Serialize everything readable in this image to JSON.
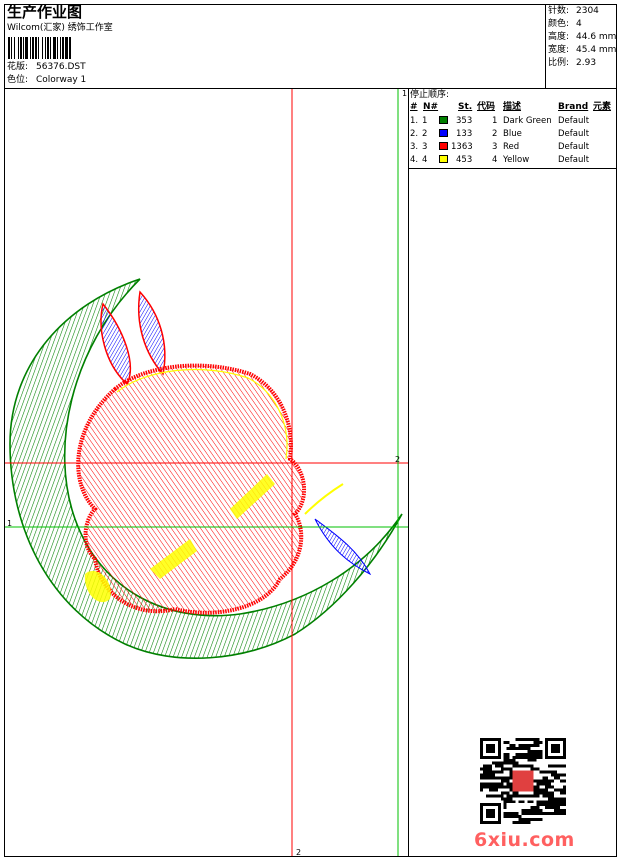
{
  "header": {
    "title": "生产作业图",
    "company": "Wilcom(汇家) 绣饰工作室",
    "design_label": "花版:",
    "design_value": "56376.DST",
    "colorway_label": "色位:",
    "colorway_value": "Colorway 1"
  },
  "stats": [
    {
      "label": "针数:",
      "value": "2304"
    },
    {
      "label": "颜色:",
      "value": "4"
    },
    {
      "label": "高度:",
      "value": "44.6 mm"
    },
    {
      "label": "宽度:",
      "value": "45.4 mm"
    },
    {
      "label": "比例:",
      "value": "2.93"
    }
  ],
  "stop_sequence": {
    "title": "停止顺序:",
    "columns": [
      "#",
      "N#",
      "St.",
      "代码",
      "描述",
      "Brand",
      "元素"
    ],
    "rows": [
      {
        "num": "1.",
        "n": "1",
        "color": "#008000",
        "st": "353",
        "code": "1",
        "desc": "Dark Green",
        "brand": "Default"
      },
      {
        "num": "2.",
        "n": "2",
        "color": "#0000ff",
        "st": "133",
        "code": "2",
        "desc": "Blue",
        "brand": "Default"
      },
      {
        "num": "3.",
        "n": "3",
        "color": "#ff0000",
        "st": "1363",
        "code": "3",
        "desc": "Red",
        "brand": "Default"
      },
      {
        "num": "4.",
        "n": "4",
        "color": "#ffff00",
        "st": "453",
        "code": "4",
        "desc": "Yellow",
        "brand": "Default"
      }
    ]
  },
  "axis_labels": {
    "top_right": "1",
    "h_red": "2",
    "h_green": "1",
    "v_red_bottom": "2"
  },
  "watermark": "6xiu.com",
  "colors": {
    "green": "#008000",
    "blue": "#0000ff",
    "red": "#ff0000",
    "yellow": "#ffff00",
    "guide_red": "#ff0000",
    "guide_green": "#00c000"
  },
  "icons": [
    "barcode-icon",
    "qr-code-icon"
  ]
}
